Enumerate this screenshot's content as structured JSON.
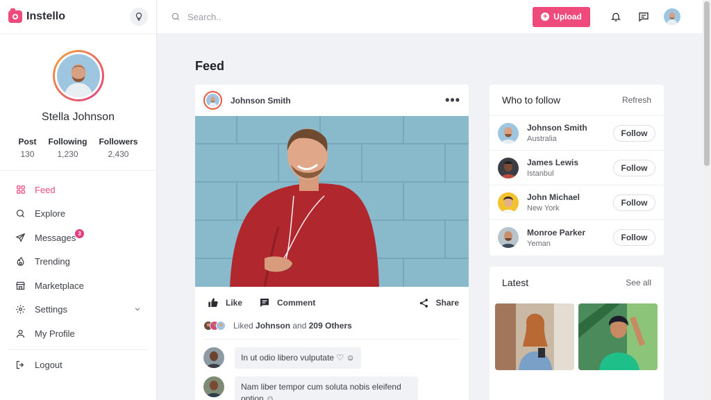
{
  "app": {
    "name": "Instello"
  },
  "search": {
    "placeholder": "Search.."
  },
  "topbar": {
    "upload_label": "Upload"
  },
  "profile": {
    "name": "Stella Johnson",
    "stats": [
      {
        "label": "Post",
        "value": "130"
      },
      {
        "label": "Following",
        "value": "1,230"
      },
      {
        "label": "Followers",
        "value": "2,430"
      }
    ]
  },
  "nav": {
    "items": [
      {
        "label": "Feed",
        "icon": "grid-icon",
        "active": true
      },
      {
        "label": "Explore",
        "icon": "search-icon"
      },
      {
        "label": "Messages",
        "icon": "send-icon",
        "badge": "3"
      },
      {
        "label": "Trending",
        "icon": "flame-icon"
      },
      {
        "label": "Marketplace",
        "icon": "store-icon"
      },
      {
        "label": "Settings",
        "icon": "gear-icon"
      },
      {
        "label": "My Profile",
        "icon": "user-icon"
      }
    ],
    "logout": "Logout"
  },
  "feed": {
    "title": "Feed",
    "post": {
      "author": "Johnson Smith",
      "actions": {
        "like": "Like",
        "comment": "Comment",
        "share": "Share"
      },
      "likes": {
        "prefix": "Liked",
        "name": "Johnson",
        "connector": "and",
        "others": "209 Others"
      },
      "comments": [
        {
          "text": "In ut odio libero vulputate"
        },
        {
          "text": "Nam liber tempor cum soluta nobis eleifend option"
        }
      ]
    }
  },
  "who_to_follow": {
    "title": "Who to follow",
    "refresh": "Refresh",
    "follow_label": "Follow",
    "people": [
      {
        "name": "Johnson Smith",
        "location": "Australia"
      },
      {
        "name": "James Lewis",
        "location": "Istanbul"
      },
      {
        "name": "John Michael",
        "location": "New York"
      },
      {
        "name": "Monroe Parker",
        "location": "Yeman"
      }
    ]
  },
  "latest": {
    "title": "Latest",
    "see_all": "See all"
  },
  "colors": {
    "accent": "#ee4a7c",
    "ring_start": "#f4a23a",
    "ring_end": "#e23d7f"
  }
}
